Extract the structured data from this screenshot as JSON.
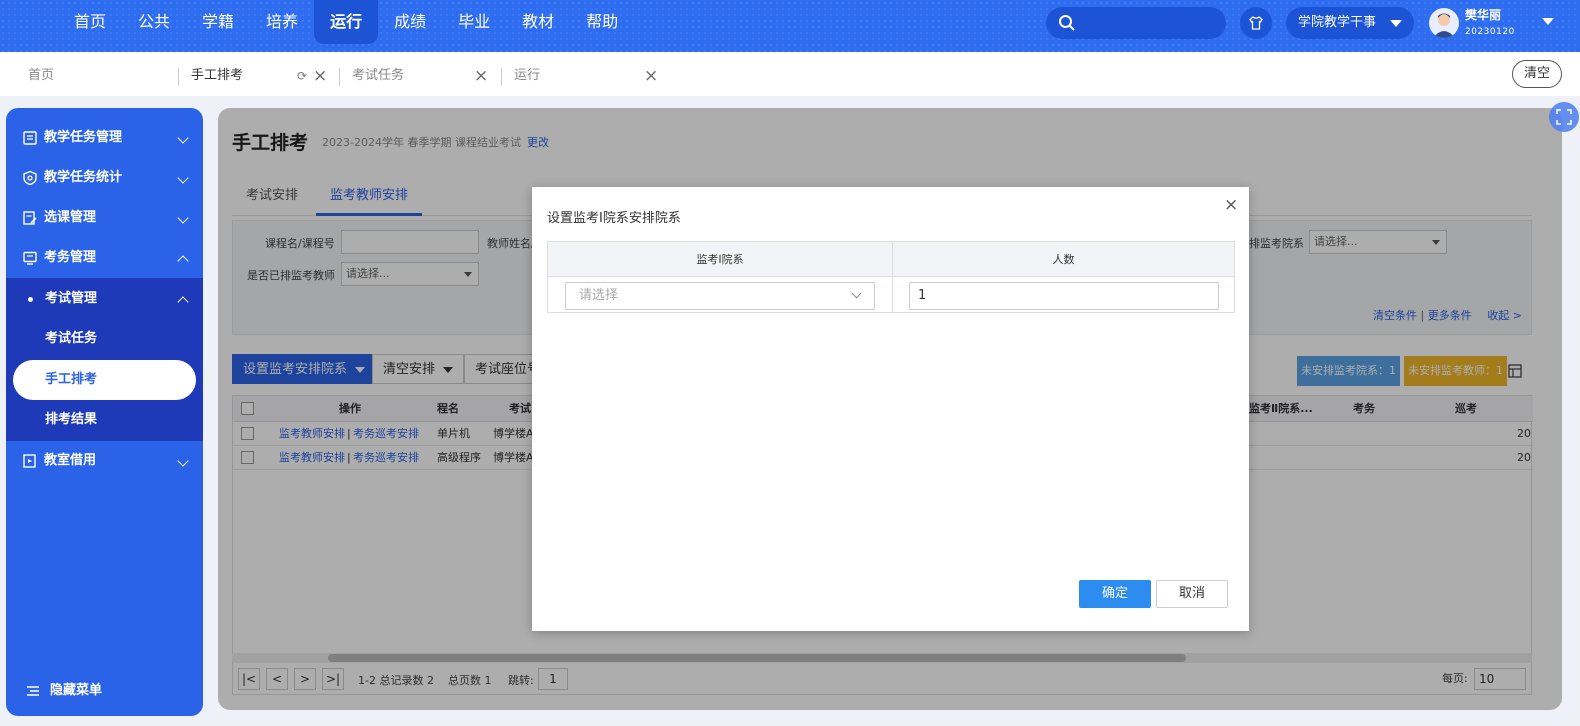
{
  "topnav": {
    "items": [
      "首页",
      "公共",
      "学籍",
      "培养",
      "运行",
      "成绩",
      "毕业",
      "教材",
      "帮助"
    ],
    "active_index": 4,
    "role_label": "学院教学干事",
    "user_name": "樊华丽",
    "user_id": "20230120"
  },
  "tabs": {
    "items": [
      "首页",
      "手工排考",
      "考试任务",
      "运行"
    ],
    "active_index": 1,
    "clear_label": "清空"
  },
  "sidebar": {
    "items": [
      "教学任务管理",
      "教学任务统计",
      "选课管理",
      "考务管理"
    ],
    "group_label": "考试管理",
    "sub_items": [
      "考试任务",
      "手工排考",
      "排考结果"
    ],
    "active_sub_index": 1,
    "after_item": "教室借用",
    "hide_label": "隐藏菜单"
  },
  "main": {
    "title": "手工排考",
    "subtitle": "2023-2024学年 春季学期 课程结业考试",
    "change_link": "更改",
    "subtabs": [
      "考试安排",
      "监考教师安排"
    ],
    "active_subtab": 1,
    "filters": {
      "course_label": "课程名/课程号",
      "teacher_label": "教师姓名/",
      "dept_label": "排监考院系",
      "dept_placeholder": "请选择...",
      "assigned_label": "是否已排监考教师",
      "assigned_placeholder": "请选择...",
      "clear_link": "清空条件",
      "more_link": "更多条件",
      "collapse_link": "收起 >"
    },
    "toolbar": {
      "set_dept_btn": "设置监考安排院系",
      "clear_btn": "清空安排",
      "seat_btn": "考试座位号"
    },
    "badges": {
      "no_dept": "未安排监考院系：1",
      "no_teacher": "未安排监考教师：1"
    },
    "grid": {
      "headers": [
        "操作",
        "程名",
        "考试",
        "监考Ⅱ院系...",
        "考务",
        "巡考"
      ],
      "rows": [
        {
          "op1": "监考教师安排",
          "op2": "考务巡考安排",
          "course": "单片机",
          "room": "博学楼A",
          "tail": "20"
        },
        {
          "op1": "监考教师安排",
          "op2": "考务巡考安排",
          "course": "高级程序",
          "room": "博学楼A",
          "tail": "20"
        }
      ]
    },
    "pager": {
      "summary": "1-2 总记录数 2",
      "pages": "总页数 1",
      "jump_label": "跳转:",
      "jump_value": "1",
      "per_page_label": "每页:",
      "per_page_value": "10"
    }
  },
  "dialog": {
    "title": "设置监考Ⅰ院系安排院系",
    "col1": "监考Ⅰ院系",
    "col2": "人数",
    "select_placeholder": "请选择",
    "count_value": "1",
    "ok_label": "确定",
    "cancel_label": "取消"
  }
}
